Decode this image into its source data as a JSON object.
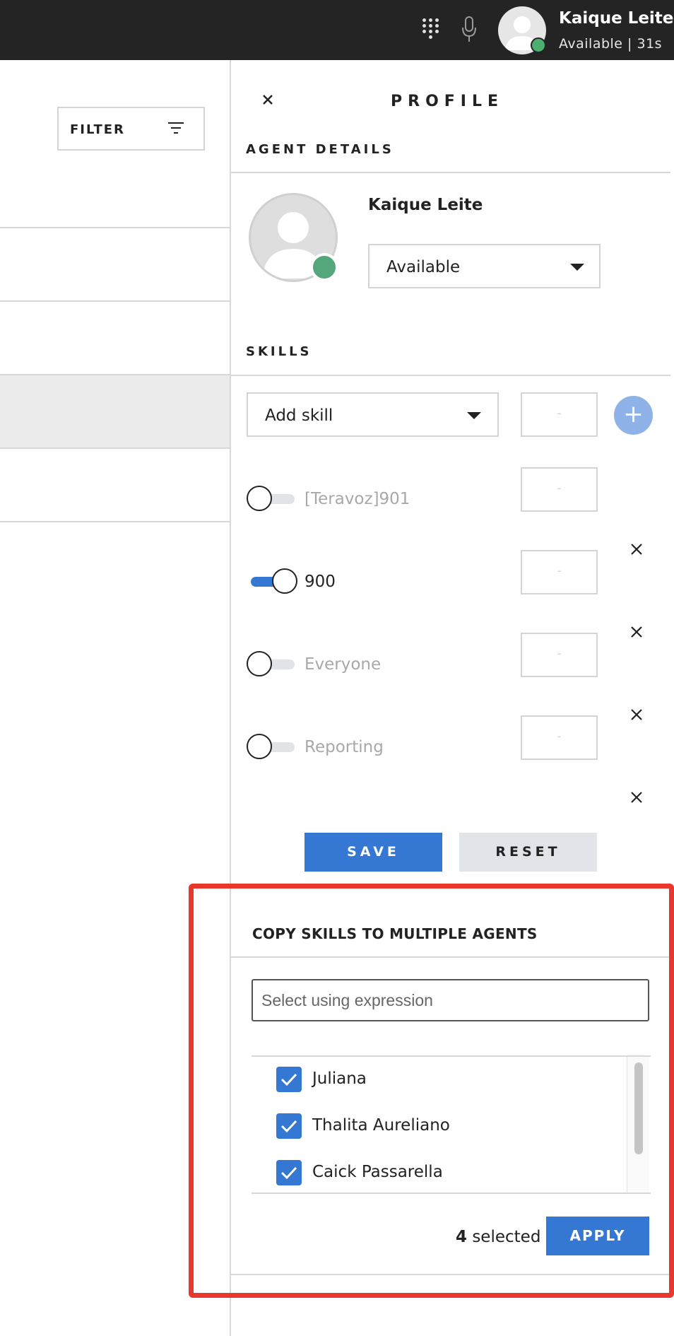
{
  "topbar": {
    "user_name": "Kaique Leite",
    "user_status": "Available | 31s",
    "icons": [
      "dialpad-icon",
      "microphone-icon",
      "avatar"
    ]
  },
  "left": {
    "filter_label": "FILTER"
  },
  "profile": {
    "title": "PROFILE",
    "agent_details_heading": "AGENT DETAILS",
    "agent_name": "Kaique Leite",
    "status_value": "Available",
    "skills_heading": "SKILLS",
    "add_skill_placeholder": "Add skill",
    "level_placeholder": "-",
    "skills": [
      {
        "name": "[Teravoz]901",
        "enabled": false,
        "level": "-"
      },
      {
        "name": "900",
        "enabled": true,
        "level": "-"
      },
      {
        "name": "Everyone",
        "enabled": false,
        "level": "-"
      },
      {
        "name": "Reporting",
        "enabled": false,
        "level": "-"
      }
    ],
    "save_label": "SAVE",
    "reset_label": "RESET"
  },
  "copy_skills": {
    "heading": "COPY SKILLS TO MULTIPLE AGENTS",
    "expression_placeholder": "Select using expression",
    "agents": [
      {
        "name": "Juliana",
        "checked": true
      },
      {
        "name": "Thalita Aureliano",
        "checked": true
      },
      {
        "name": "Caick Passarella",
        "checked": true
      }
    ],
    "selected_count": "4",
    "selected_suffix": " selected",
    "apply_label": "APPLY"
  },
  "colors": {
    "accent": "#3578d4",
    "online": "#54a77a",
    "highlight_border": "#e8382e",
    "topbar": "#242424"
  }
}
